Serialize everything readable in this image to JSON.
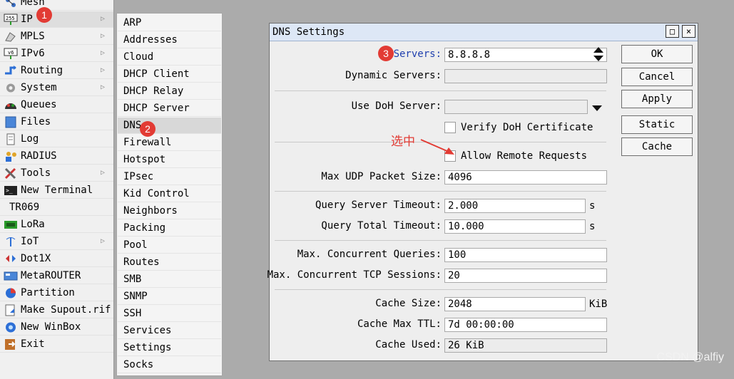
{
  "left_menu": {
    "items": [
      {
        "label": "Mesh",
        "icon": "mesh-icon",
        "submenu": false
      },
      {
        "label": "IP",
        "icon": "ip-icon",
        "submenu": true,
        "active": true
      },
      {
        "label": "MPLS",
        "icon": "mpls-icon",
        "submenu": true
      },
      {
        "label": "IPv6",
        "icon": "ipv6-icon",
        "submenu": true
      },
      {
        "label": "Routing",
        "icon": "routing-icon",
        "submenu": true
      },
      {
        "label": "System",
        "icon": "gear-icon",
        "submenu": true
      },
      {
        "label": "Queues",
        "icon": "queues-icon",
        "submenu": false
      },
      {
        "label": "Files",
        "icon": "files-icon",
        "submenu": false
      },
      {
        "label": "Log",
        "icon": "log-icon",
        "submenu": false
      },
      {
        "label": "RADIUS",
        "icon": "radius-icon",
        "submenu": false
      },
      {
        "label": "Tools",
        "icon": "tools-icon",
        "submenu": true
      },
      {
        "label": "New Terminal",
        "icon": "terminal-icon",
        "submenu": false
      },
      {
        "label": "TR069",
        "icon": "",
        "submenu": false
      },
      {
        "label": "LoRa",
        "icon": "lora-icon",
        "submenu": false
      },
      {
        "label": "IoT",
        "icon": "iot-icon",
        "submenu": true
      },
      {
        "label": "Dot1X",
        "icon": "dot1x-icon",
        "submenu": false
      },
      {
        "label": "MetaROUTER",
        "icon": "metarouter-icon",
        "submenu": false
      },
      {
        "label": "Partition",
        "icon": "partition-icon",
        "submenu": false
      },
      {
        "label": "Make Supout.rif",
        "icon": "supout-icon",
        "submenu": false
      },
      {
        "label": "New WinBox",
        "icon": "winbox-icon",
        "submenu": false
      },
      {
        "label": "Exit",
        "icon": "exit-icon",
        "submenu": false
      }
    ]
  },
  "ip_submenu": {
    "items": [
      "ARP",
      "Addresses",
      "Cloud",
      "DHCP Client",
      "DHCP Relay",
      "DHCP Server",
      "DNS",
      "Firewall",
      "Hotspot",
      "IPsec",
      "Kid Control",
      "Neighbors",
      "Packing",
      "Pool",
      "Routes",
      "SMB",
      "SNMP",
      "SSH",
      "Services",
      "Settings",
      "Socks"
    ],
    "active_index": 6
  },
  "step_badges": [
    "1",
    "2",
    "3"
  ],
  "dns_dialog": {
    "title": "DNS Settings",
    "title_buttons": {
      "maximize": "□",
      "close": "×"
    },
    "servers": {
      "label": "Servers:",
      "value": "8.8.8.8"
    },
    "dynamic_servers": {
      "label": "Dynamic Servers:",
      "value": ""
    },
    "use_doh_server": {
      "label": "Use DoH Server:",
      "value": ""
    },
    "verify_doh_certificate": {
      "label": "Verify DoH Certificate",
      "checked": false
    },
    "allow_remote_requests": {
      "label": "Allow Remote Requests",
      "checked": false
    },
    "max_udp_packet_size": {
      "label": "Max UDP Packet Size:",
      "value": "4096"
    },
    "query_server_timeout": {
      "label": "Query Server Timeout:",
      "value": "2.000",
      "unit": "s"
    },
    "query_total_timeout": {
      "label": "Query Total Timeout:",
      "value": "10.000",
      "unit": "s"
    },
    "max_concurrent_queries": {
      "label": "Max. Concurrent Queries:",
      "value": "100"
    },
    "max_concurrent_tcp_sessions": {
      "label": "Max. Concurrent TCP Sessions:",
      "value": "20"
    },
    "cache_size": {
      "label": "Cache Size:",
      "value": "2048",
      "unit": "KiB"
    },
    "cache_max_ttl": {
      "label": "Cache Max TTL:",
      "value": "7d 00:00:00"
    },
    "cache_used": {
      "label": "Cache Used:",
      "value": "26 KiB"
    },
    "buttons": {
      "ok": "OK",
      "cancel": "Cancel",
      "apply": "Apply",
      "static": "Static",
      "cache": "Cache"
    }
  },
  "annotation": {
    "text": "选中"
  },
  "watermark": "CSDN @alfiy",
  "colors": {
    "annotation_red": "#e23b34",
    "titlebar": "#dde7f6",
    "link_blue": "#1f3fae"
  }
}
